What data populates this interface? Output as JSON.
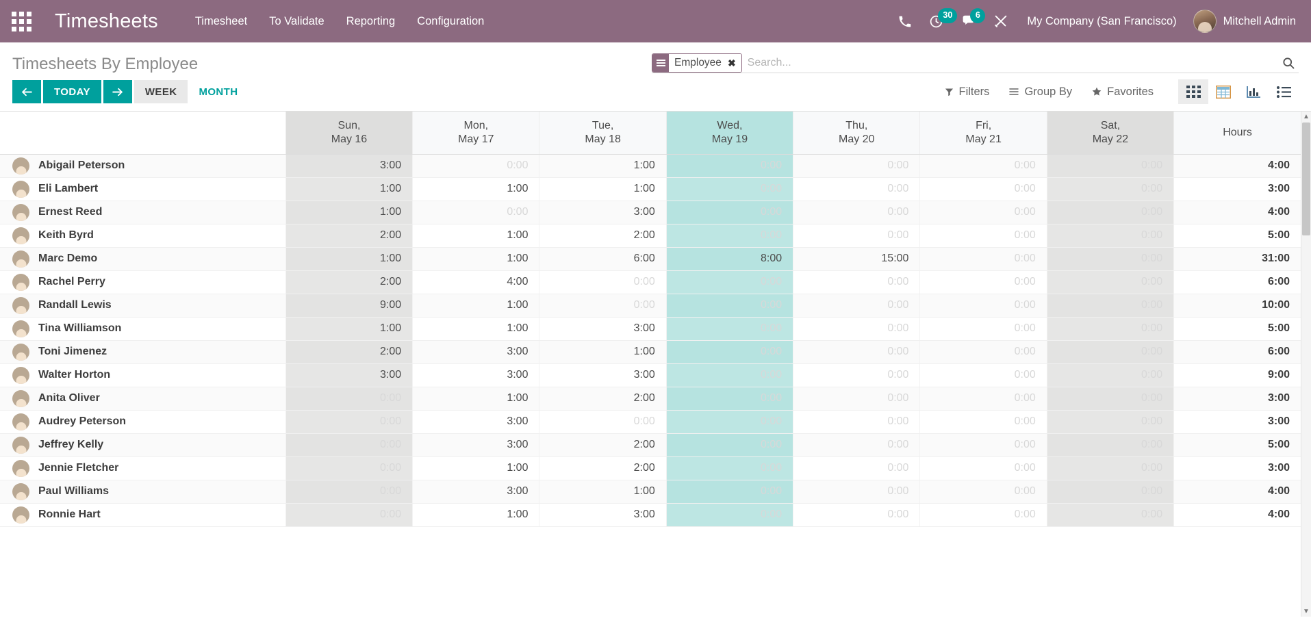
{
  "navbar": {
    "apps_icon": "apps-grid-icon",
    "brand": "Timesheets",
    "menu": [
      {
        "label": "Timesheet"
      },
      {
        "label": "To Validate"
      },
      {
        "label": "Reporting"
      },
      {
        "label": "Configuration"
      }
    ],
    "phone_icon": "phone-icon",
    "activities_icon": "clock-activity-icon",
    "activities_count": "30",
    "messages_icon": "chat-bubble-icon",
    "messages_count": "6",
    "debug_icon": "wrench-screwdriver-icon",
    "company": "My Company (San Francisco)",
    "user": "Mitchell Admin",
    "accent": "#8c6a80",
    "badge_color": "#00a09d"
  },
  "control_panel": {
    "title": "Timesheets By Employee",
    "search": {
      "facet_icon": "list-lines-icon",
      "facet_label": "Employee",
      "facet_close_icon": "close-x-icon",
      "placeholder": "Search...",
      "value": "",
      "search_icon": "search-icon"
    },
    "nav": {
      "prev_icon": "arrow-left-icon",
      "today_label": "TODAY",
      "next_icon": "arrow-right-icon",
      "scales": [
        {
          "label": "WEEK",
          "active": true
        },
        {
          "label": "MONTH",
          "active": false
        }
      ]
    },
    "dropdowns": [
      {
        "label": "Filters",
        "icon": "filter-funnel-icon"
      },
      {
        "label": "Group By",
        "icon": "bars-icon"
      },
      {
        "label": "Favorites",
        "icon": "star-icon"
      }
    ],
    "views": [
      {
        "name": "grid-view",
        "icon": "grid-squares-icon",
        "active": true
      },
      {
        "name": "pivot-view",
        "icon": "table-icon",
        "active": false
      },
      {
        "name": "graph-view",
        "icon": "bar-chart-icon",
        "active": false
      },
      {
        "name": "list-view",
        "icon": "list-icon",
        "active": false
      }
    ],
    "teal": "#00a09d"
  },
  "grid": {
    "name_header": "",
    "columns": [
      {
        "dow": "Sun,",
        "date": "May 16",
        "weekend": true,
        "today": false
      },
      {
        "dow": "Mon,",
        "date": "May 17",
        "weekend": false,
        "today": false
      },
      {
        "dow": "Tue,",
        "date": "May 18",
        "weekend": false,
        "today": false
      },
      {
        "dow": "Wed,",
        "date": "May 19",
        "weekend": false,
        "today": true
      },
      {
        "dow": "Thu,",
        "date": "May 20",
        "weekend": false,
        "today": false
      },
      {
        "dow": "Fri,",
        "date": "May 21",
        "weekend": false,
        "today": false
      },
      {
        "dow": "Sat,",
        "date": "May 22",
        "weekend": true,
        "today": false
      }
    ],
    "total_header": "Hours",
    "rows": [
      {
        "employee": "Abigail Peterson",
        "values": [
          "3:00",
          "0:00",
          "1:00",
          "0:00",
          "0:00",
          "0:00",
          "0:00"
        ],
        "total": "4:00"
      },
      {
        "employee": "Eli Lambert",
        "values": [
          "1:00",
          "1:00",
          "1:00",
          "0:00",
          "0:00",
          "0:00",
          "0:00"
        ],
        "total": "3:00"
      },
      {
        "employee": "Ernest Reed",
        "values": [
          "1:00",
          "0:00",
          "3:00",
          "0:00",
          "0:00",
          "0:00",
          "0:00"
        ],
        "total": "4:00"
      },
      {
        "employee": "Keith Byrd",
        "values": [
          "2:00",
          "1:00",
          "2:00",
          "0:00",
          "0:00",
          "0:00",
          "0:00"
        ],
        "total": "5:00"
      },
      {
        "employee": "Marc Demo",
        "values": [
          "1:00",
          "1:00",
          "6:00",
          "8:00",
          "15:00",
          "0:00",
          "0:00"
        ],
        "total": "31:00"
      },
      {
        "employee": "Rachel Perry",
        "values": [
          "2:00",
          "4:00",
          "0:00",
          "0:00",
          "0:00",
          "0:00",
          "0:00"
        ],
        "total": "6:00"
      },
      {
        "employee": "Randall Lewis",
        "values": [
          "9:00",
          "1:00",
          "0:00",
          "0:00",
          "0:00",
          "0:00",
          "0:00"
        ],
        "total": "10:00"
      },
      {
        "employee": "Tina Williamson",
        "values": [
          "1:00",
          "1:00",
          "3:00",
          "0:00",
          "0:00",
          "0:00",
          "0:00"
        ],
        "total": "5:00"
      },
      {
        "employee": "Toni Jimenez",
        "values": [
          "2:00",
          "3:00",
          "1:00",
          "0:00",
          "0:00",
          "0:00",
          "0:00"
        ],
        "total": "6:00"
      },
      {
        "employee": "Walter Horton",
        "values": [
          "3:00",
          "3:00",
          "3:00",
          "0:00",
          "0:00",
          "0:00",
          "0:00"
        ],
        "total": "9:00"
      },
      {
        "employee": "Anita Oliver",
        "values": [
          "0:00",
          "1:00",
          "2:00",
          "0:00",
          "0:00",
          "0:00",
          "0:00"
        ],
        "total": "3:00"
      },
      {
        "employee": "Audrey Peterson",
        "values": [
          "0:00",
          "3:00",
          "0:00",
          "0:00",
          "0:00",
          "0:00",
          "0:00"
        ],
        "total": "3:00"
      },
      {
        "employee": "Jeffrey Kelly",
        "values": [
          "0:00",
          "3:00",
          "2:00",
          "0:00",
          "0:00",
          "0:00",
          "0:00"
        ],
        "total": "5:00"
      },
      {
        "employee": "Jennie Fletcher",
        "values": [
          "0:00",
          "1:00",
          "2:00",
          "0:00",
          "0:00",
          "0:00",
          "0:00"
        ],
        "total": "3:00"
      },
      {
        "employee": "Paul Williams",
        "values": [
          "0:00",
          "3:00",
          "1:00",
          "0:00",
          "0:00",
          "0:00",
          "0:00"
        ],
        "total": "4:00"
      },
      {
        "employee": "Ronnie Hart",
        "values": [
          "0:00",
          "1:00",
          "3:00",
          "0:00",
          "0:00",
          "0:00",
          "0:00"
        ],
        "total": "4:00"
      }
    ],
    "scrollbar": {
      "up_icon": "chevron-up-icon",
      "down_icon": "chevron-down-icon"
    }
  }
}
